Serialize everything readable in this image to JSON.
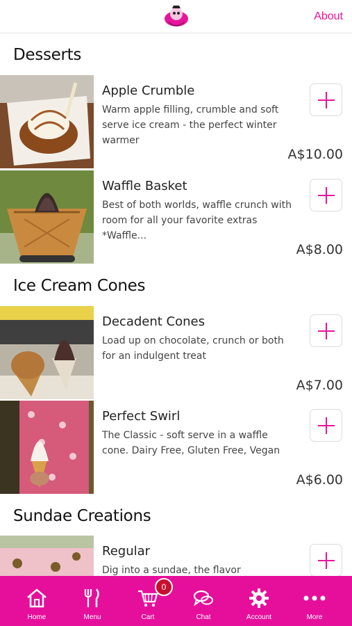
{
  "header": {
    "about_label": "About",
    "logo_icon": "ice-cream-mascot-logo"
  },
  "accent_color": "#e6159b",
  "sections": [
    {
      "title": "Desserts",
      "items": [
        {
          "name": "Apple Crumble",
          "description": "Warm apple filling, crumble and soft serve ice cream - the perfect winter warmer",
          "price": "A$10.00"
        },
        {
          "name": "Waffle Basket",
          "description": "Best of both worlds, waffle crunch with room for all your favorite extras *Waffle...",
          "price": "A$8.00"
        }
      ]
    },
    {
      "title": "Ice Cream Cones",
      "items": [
        {
          "name": "Decadent Cones",
          "description": "Load up on chocolate, crunch or both for an indulgent treat",
          "price": "A$7.00"
        },
        {
          "name": "Perfect Swirl",
          "description": "The Classic - soft serve in a waffle cone. Dairy Free, Gluten Free, Vegan",
          "price": "A$6.00"
        }
      ]
    },
    {
      "title": "Sundae Creations",
      "items": [
        {
          "name": "Regular",
          "description": "Dig into a sundae, the flavor combinations",
          "price": ""
        }
      ]
    }
  ],
  "bottom_nav": [
    {
      "label": "Home",
      "icon": "home-icon"
    },
    {
      "label": "Menu",
      "icon": "fork-knife-icon"
    },
    {
      "label": "Cart",
      "icon": "cart-icon",
      "badge": "0"
    },
    {
      "label": "Chat",
      "icon": "chat-icon"
    },
    {
      "label": "Account",
      "icon": "gear-icon"
    },
    {
      "label": "More",
      "icon": "more-dots-icon"
    }
  ]
}
